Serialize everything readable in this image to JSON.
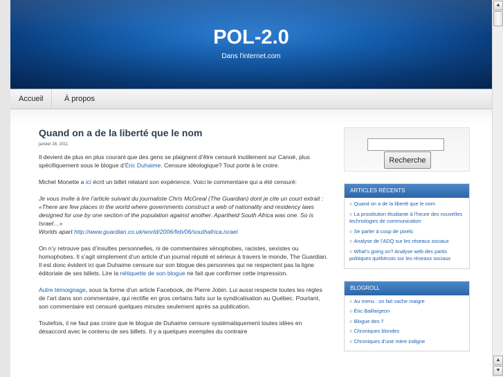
{
  "header": {
    "title": "POL-2.0",
    "tagline": "Dans l'internet.com"
  },
  "nav": {
    "home": "Accueil",
    "about": "À propos"
  },
  "post": {
    "title": "Quand on a de la liberté que le nom",
    "date": "janvier 28, 2011",
    "p1_pre": "Il devient de plus en plus courant que des gens se plaignent d’être censuré inutilement sur Canoë, plus spécifiquement sous le blogue d’",
    "p1_link": "Éric Duhaime",
    "p1_post": ". Censure idéologique? Tout porte à le croire.",
    "p2_pre": "Michel Monette a ",
    "p2_link": "ici",
    "p2_post": " écrit un billet relatant son expérience. Voici le commentaire qui a été censuré:",
    "q_line1": "Je vous invite à lire l’article suivant du journaliste Chris McGreal (The Guardian) dont je cite un court extrait :",
    "q_line2": "«There are few places in the world where governments construct a web of nationality and residency laws designed for use by one section of the population against another. Apartheid South Africa was one. So is Israel…»",
    "q_line3_pre": "Worlds apart ",
    "q_line3_link": "http://www.guardian.co.uk/world/2006/feb/06/southafrica.israel",
    "p3_pre": "On n’y retrouve pas d’insultes personnelles, ni de commentaires xénophobes, racistes, sexistes ou homophobes. Il s’agit simplement d’un article d’un journal réputé et sérieux à travers le monde, The Guardian. Il est donc évident ici que Duhaime censure sur son blogue des personnes qui ne respectent pas la ligne éditoriale de ses billets. Lire la ",
    "p3_link": "nétiquette de son blogue",
    "p3_post": " ne fait que confirmer cette impression.",
    "p4_link": "Autre témoignage",
    "p4_post": ", sous la forme d’un article Facebook, de Pierre Jobin. Lui aussi respecte toutes les règles de l’art dans son commentaire, qui rectifie en gros certains faits sur la syndicalisation au Québec. Pourtant, son commentaire est censuré quelques minutes seulement après sa publication.",
    "p5": "Toutefois, il ne faut pas croire que le blogue de Duhaime censure systématiquement toutes idées en désaccord avec le contenu de ses billets. Il y a quelques exemples du contraire"
  },
  "sidebar": {
    "search_button": "Recherche",
    "recent_title": "ARTICLES RÉCENTS",
    "recent_items": [
      "Quand on a de la liberté que le nom",
      "La prostitution étudiante à l’heure des nouvelles technologies de communication",
      "Se parler à coup de pixels",
      "Analyse de l’ADQ sur les réseaux sociaux",
      "What’s going on? Analyse web des partis politiques québécois sur les réseaux sociaux"
    ],
    "blogroll_title": "BLOGROLL",
    "blogroll_items": [
      "Au menu : on fait vache maigre",
      "Éric Baillargeon",
      "Blogue des 7",
      "Chroniques blondes",
      "Chroniques d’une mère indigne"
    ]
  },
  "scrollbar": {
    "up_arrow": "▲",
    "down_arrow": "▼"
  }
}
